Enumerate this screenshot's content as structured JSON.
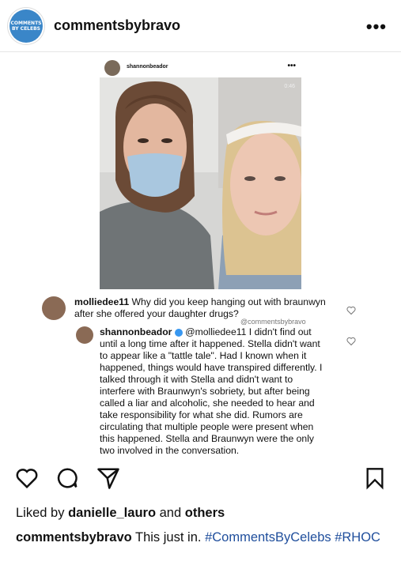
{
  "header": {
    "avatar_text": "COMMENTS BY CELEBS",
    "username": "commentsbybravo",
    "more_label": "•••"
  },
  "embed": {
    "username": "shannonbeador",
    "more_label": "•••",
    "video_time": "0:46",
    "comment1": {
      "username": "molliedee11",
      "text": "Why did you keep hanging out with braunwyn after she offered your daughter drugs?"
    },
    "credit": "@commentsbybravo",
    "comment2": {
      "username": "shannonbeador",
      "mention": "@molliedee11",
      "text": "I didn't find out until a long time after it happened. Stella didn't want to appear like a \"tattle tale\". Had I known when it happened, things would have transpired differently. I talked through it with Stella and didn't want to interfere with Braunwyn's sobriety, but after being called a liar and alcoholic, she needed to hear and take responsibility for what she did. Rumors are circulating that multiple people were present when this happened. Stella and Braunwyn were the only two involved in the conversation."
    }
  },
  "likes": {
    "prefix": "Liked by",
    "user": "danielle_lauro",
    "and": "and",
    "others": "others"
  },
  "caption": {
    "username": "commentsbybravo",
    "text": "This just in.",
    "tags": [
      "#CommentsByCelebs",
      "#RHOC"
    ]
  }
}
